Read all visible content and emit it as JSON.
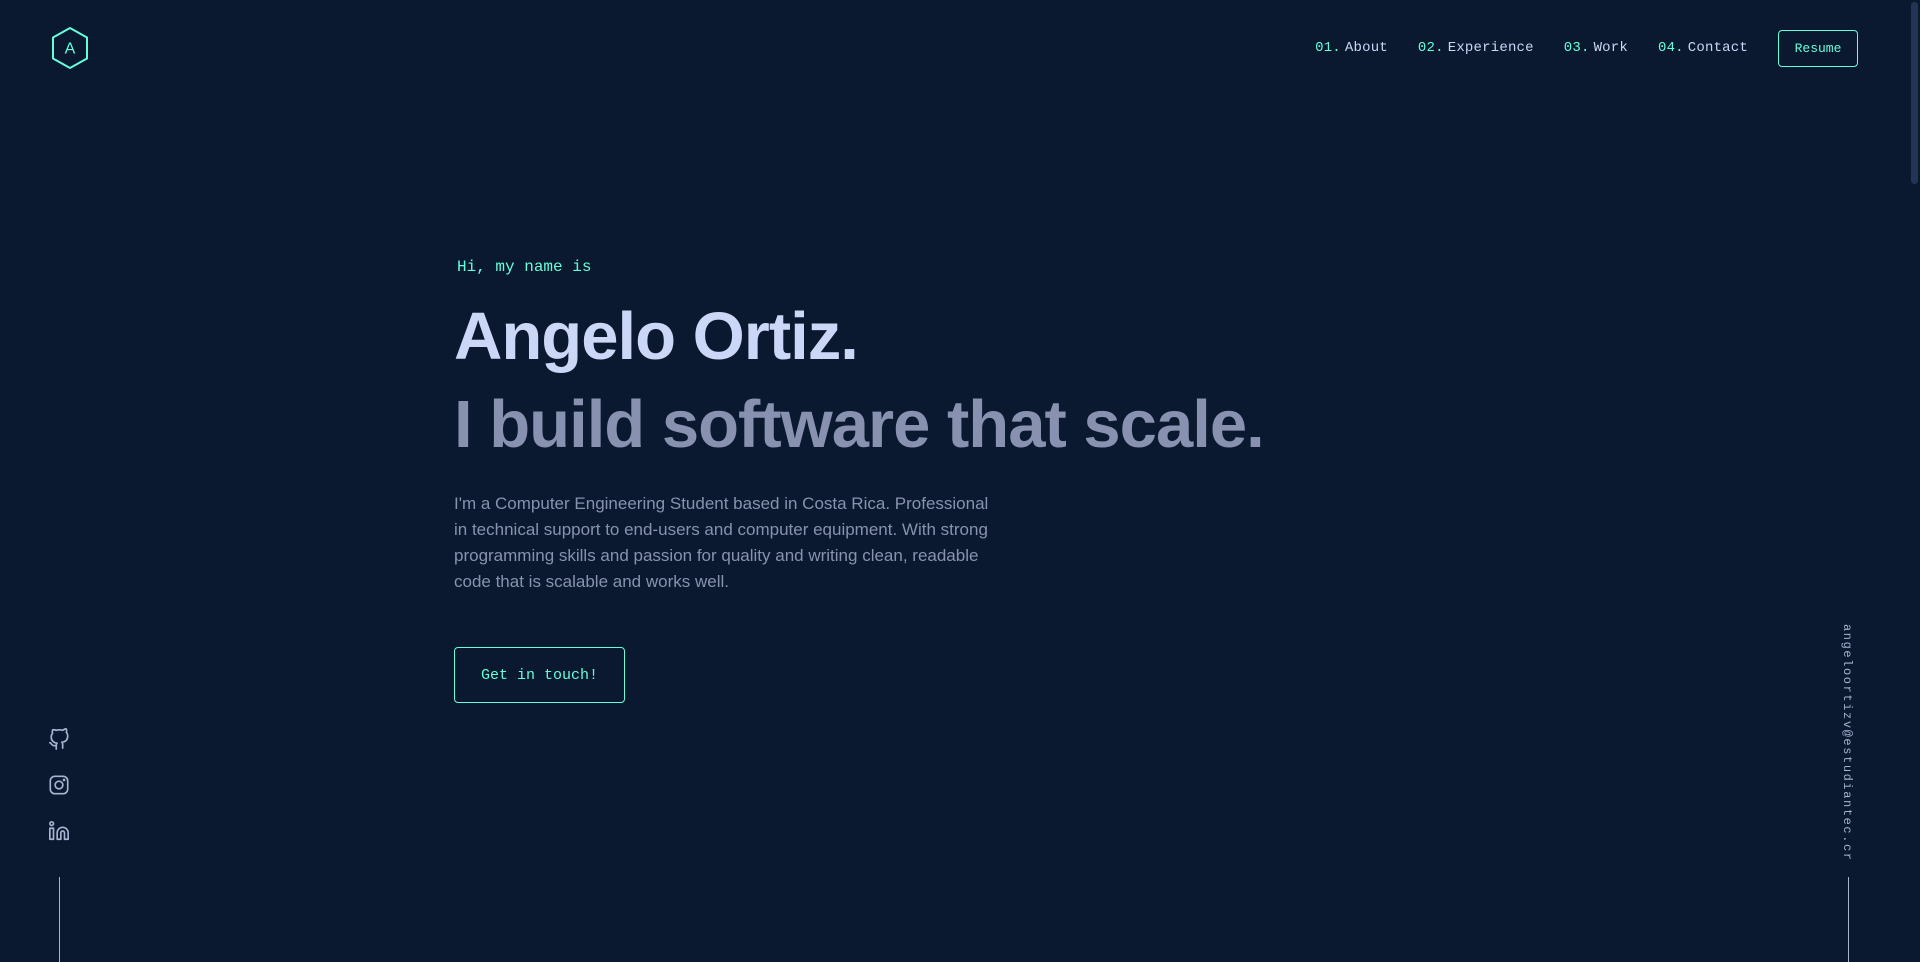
{
  "colors": {
    "background": "#0a192f",
    "accent": "#64ffda",
    "heading": "#ccd6f6",
    "text": "#8892b0"
  },
  "header": {
    "logo_letter": "A",
    "logo_icon": "hexagon-logo-icon",
    "nav": [
      {
        "num": "01.",
        "label": "About"
      },
      {
        "num": "02.",
        "label": "Experience"
      },
      {
        "num": "03.",
        "label": "Work"
      },
      {
        "num": "04.",
        "label": "Contact"
      }
    ],
    "resume_label": "Resume"
  },
  "hero": {
    "greeting": "Hi, my name is",
    "name": "Angelo Ortiz.",
    "tagline": "I build software that scale.",
    "bio": "I'm a Computer Engineering Student based in Costa Rica. Professional in technical support to end-users and computer equipment. With strong programming skills and passion for quality and writing clean, readable code that is scalable and works well.",
    "cta_label": "Get in touch!"
  },
  "social": [
    {
      "icon": "github-icon"
    },
    {
      "icon": "instagram-icon"
    },
    {
      "icon": "linkedin-icon"
    }
  ],
  "email": "angeloortizv@estudiantec.cr"
}
